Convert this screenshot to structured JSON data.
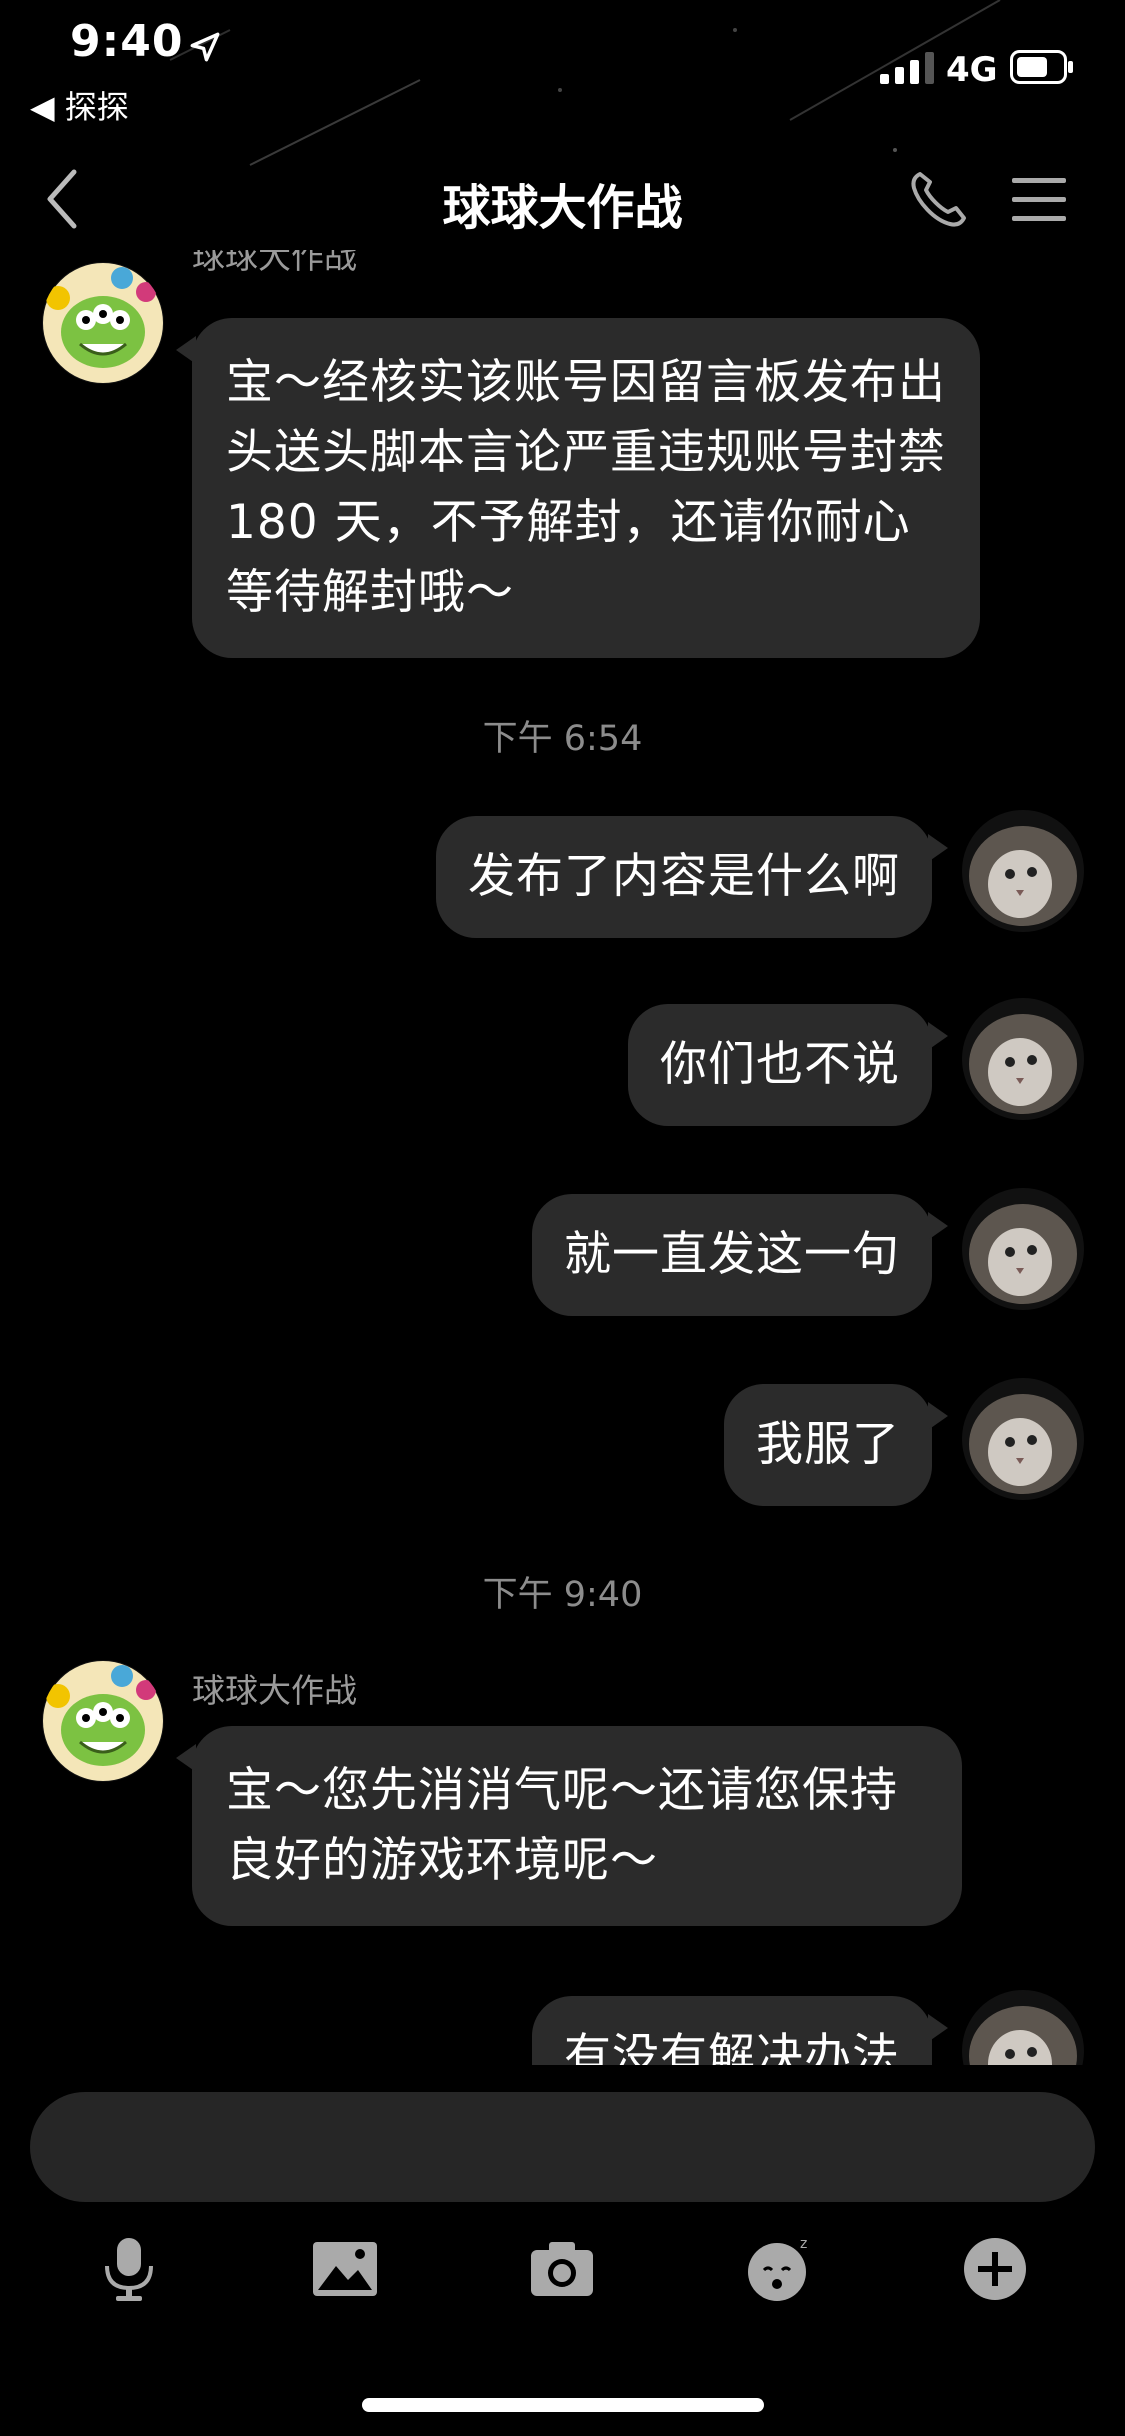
{
  "status_bar": {
    "time": "9:40",
    "back_app": "◀ 探探",
    "network": "4G",
    "icons": [
      "location-arrow-icon",
      "signal-icon",
      "battery-icon"
    ]
  },
  "nav": {
    "title": "球球大作战",
    "icons": [
      "back-chevron-icon",
      "phone-icon",
      "menu-icon"
    ]
  },
  "messages": [
    {
      "type": "incoming",
      "sender": "球球大作战",
      "text": "宝～经核实该账号因留言板发布出头送头脚本言论严重违规账号封禁 180 天，不予解封，还请你耐心等待解封哦～"
    },
    {
      "type": "timestamp",
      "text": "下午 6:54"
    },
    {
      "type": "outgoing",
      "text": "发布了内容是什么啊"
    },
    {
      "type": "outgoing",
      "text": "你们也不说"
    },
    {
      "type": "outgoing",
      "text": "就一直发这一句"
    },
    {
      "type": "outgoing",
      "text": "我服了"
    },
    {
      "type": "timestamp",
      "text": "下午 9:40"
    },
    {
      "type": "incoming",
      "sender": "球球大作战",
      "text": "宝～您先消消气呢～还请您保持良好的游戏环境呢～"
    },
    {
      "type": "outgoing",
      "text": "有没有解决办法"
    }
  ],
  "input": {
    "placeholder": ""
  },
  "toolbar": [
    "microphone-icon",
    "image-icon",
    "camera-icon",
    "emoji-icon",
    "plus-icon"
  ],
  "colors": {
    "background": "#000000",
    "bubble": "#2b2b2b",
    "timestamp": "#8c8c8c",
    "sender": "#9a9a9a"
  }
}
